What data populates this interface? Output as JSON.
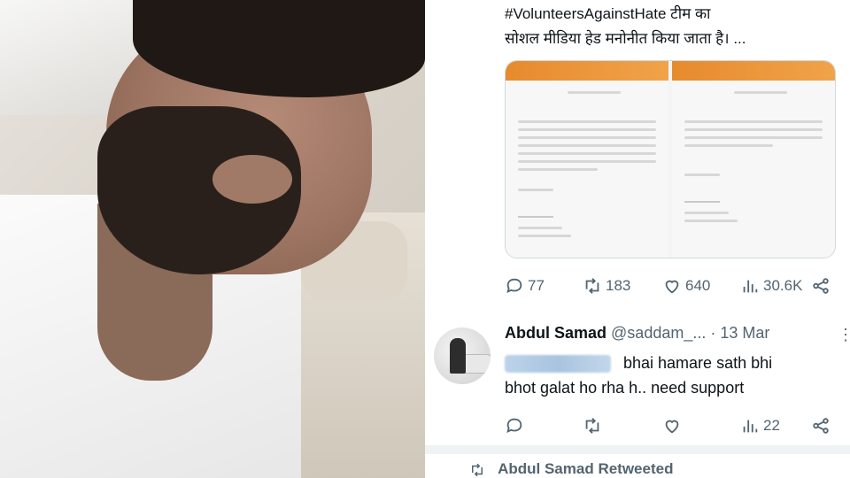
{
  "tweet": {
    "text_line1": "#VolunteersAgainstHate टीम का",
    "text_line2": "सोशल मीडिया हेड मनोनीत किया जाता है। ...",
    "replies": "77",
    "retweets": "183",
    "likes": "640",
    "views": "30.6K"
  },
  "reply": {
    "name": "Abdul Samad",
    "handle": "@saddam_...",
    "date": "· 13 Mar",
    "body_line1": "bhai hamare sath bhi",
    "body_line2": "bhot galat ho rha h.. need support",
    "replies": "",
    "retweets": "",
    "likes": "",
    "views": "22"
  },
  "retweeted_label": "Abdul Samad Retweeted",
  "colors": {
    "text": "#0f1419",
    "muted": "#536471",
    "border": "#cfd9de",
    "letterhead": "#e78a2e"
  },
  "icons": [
    "reply-icon",
    "retweet-icon",
    "like-icon",
    "views-icon",
    "share-icon",
    "more-icon"
  ]
}
